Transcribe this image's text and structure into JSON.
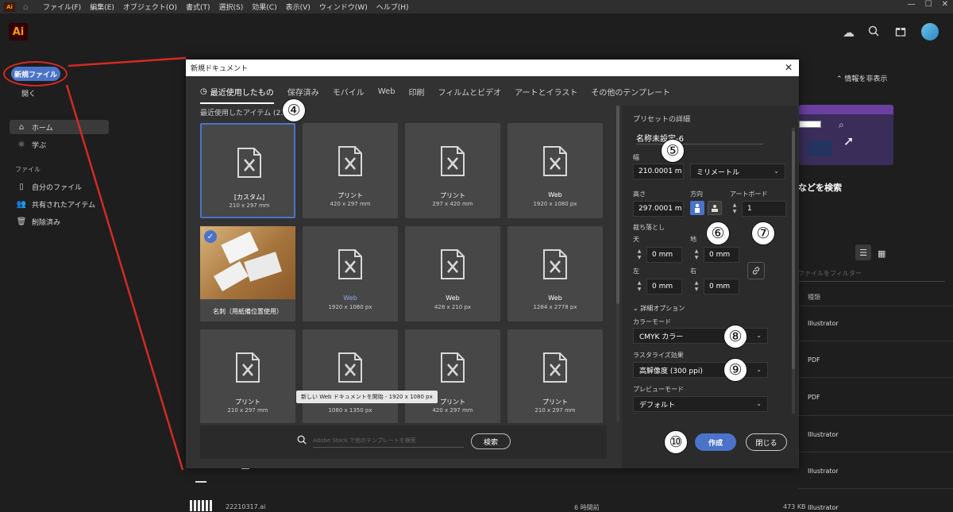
{
  "menubar": {
    "app_short": "Ai",
    "menus": [
      "ファイル(F)",
      "編集(E)",
      "オブジェクト(O)",
      "書式(T)",
      "選択(S)",
      "効果(C)",
      "表示(V)",
      "ウィンドウ(W)",
      "ヘルプ(H)"
    ],
    "window_controls": [
      "—",
      "☐",
      "✕"
    ]
  },
  "header": {
    "logo": "Ai",
    "icons": [
      "cloud-icon",
      "search-icon",
      "gift-icon",
      "avatar"
    ]
  },
  "sidebar": {
    "new_file": "新規ファイル",
    "open": "開く",
    "home": "ホーム",
    "learn": "学ぶ",
    "files_label": "ファイル",
    "my_files": "自分のファイル",
    "shared": "共有されたアイテム",
    "deleted": "削除済み"
  },
  "background": {
    "hide_info": "情報を非表示",
    "search_promo": "などを検索",
    "filter_placeholder": "ファイルをフィルター",
    "type_header": "種類",
    "file_types": [
      "Illustrator",
      "PDF",
      "PDF",
      "Illustrator",
      "Illustrator",
      "Illustrator"
    ],
    "last_file_name": "22210317.ai",
    "last_file_time": "6 時間前",
    "last_file_size": "473 KB"
  },
  "dialog": {
    "title": "新規ドキュメント",
    "tabs": [
      "最近使用したもの",
      "保存済み",
      "モバイル",
      "Web",
      "印刷",
      "フィルムとビデオ",
      "アートとイラスト",
      "その他のテンプレート"
    ],
    "recent_label": "最近使用したアイテム (21)",
    "cards": [
      {
        "name": "[カスタム]",
        "size": "210 x 297 mm",
        "selected": true
      },
      {
        "name": "プリント",
        "size": "420 x 297 mm"
      },
      {
        "name": "プリント",
        "size": "297 x 420 mm"
      },
      {
        "name": "Web",
        "size": "1920 x 1080 px"
      },
      {
        "name": "名刺（用紙備位置使用）",
        "size": "",
        "photo": true
      },
      {
        "name": "Web",
        "size": "1920 x 1080 px",
        "blue": true
      },
      {
        "name": "Web",
        "size": "428 x 210 px"
      },
      {
        "name": "Web",
        "size": "1284 x 2778 px"
      },
      {
        "name": "プリント",
        "size": "210 x 297 mm"
      },
      {
        "name": "Web",
        "size": "1080 x 1350 px"
      },
      {
        "name": "プリント",
        "size": "420 x 297 mm"
      },
      {
        "name": "プリント",
        "size": "210 x 297 mm"
      }
    ],
    "tooltip": "新しい Web ドキュメントを開始 - 1920 x 1080 px",
    "stock_placeholder": "Adobe Stock で他のテンプレートを検索",
    "stock_search": "検索",
    "preset": {
      "heading": "プリセットの詳細",
      "name": "名称未設定-6",
      "width_label": "幅",
      "width": "210.0001 m",
      "unit": "ミリメートル",
      "height_label": "高さ",
      "height": "297.0001 m",
      "orientation_label": "方向",
      "artboard_label": "アートボード",
      "artboards": "1",
      "bleed_label": "裁ち落とし",
      "top_label": "天",
      "bottom_label": "地",
      "left_label": "左",
      "right_label": "右",
      "top": "0 mm",
      "bottom": "0 mm",
      "left": "0 mm",
      "right": "0 mm",
      "advanced": "詳細オプション",
      "color_mode_label": "カラーモード",
      "color_mode": "CMYK カラー",
      "raster_label": "ラスタライズ効果",
      "raster": "高解像度 (300 ppi)",
      "preview_label": "プレビューモード",
      "preview": "デフォルト",
      "create": "作成",
      "close": "閉じる"
    }
  },
  "badges": [
    "④",
    "⑤",
    "⑥",
    "⑦",
    "⑧",
    "⑨",
    "⑩"
  ],
  "colors": {
    "accent": "#4b73c9",
    "callout_red": "#d42a24",
    "dialog_bg": "#323232",
    "app_bg": "#1e1e1e"
  }
}
